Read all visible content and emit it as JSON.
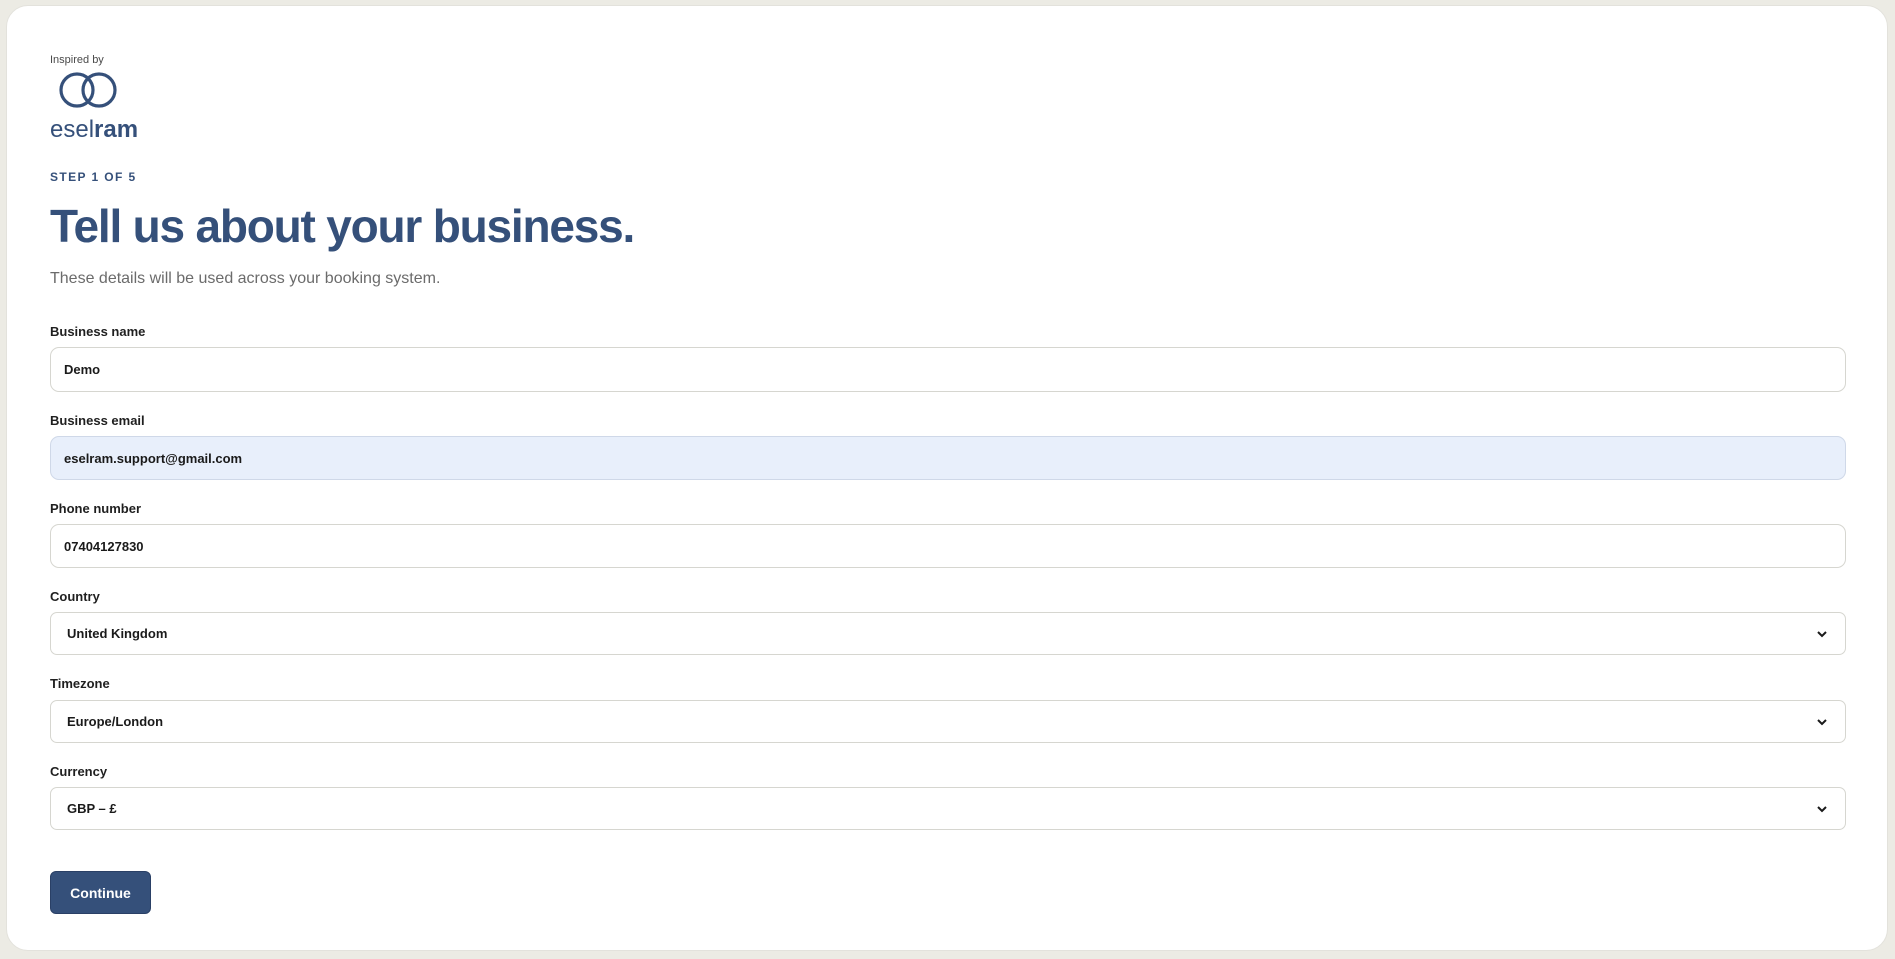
{
  "brand": {
    "inspired_by": "Inspired by",
    "logo_text_light": "esel",
    "logo_text_bold": "ram",
    "color": "#35507a"
  },
  "step": "STEP 1 OF 5",
  "title": "Tell us about your business.",
  "subtitle": "These details will be used across your booking system.",
  "fields": {
    "business_name": {
      "label": "Business name",
      "value": "Demo"
    },
    "business_email": {
      "label": "Business email",
      "value": "eselram.support@gmail.com"
    },
    "phone": {
      "label": "Phone number",
      "value": "07404127830"
    },
    "country": {
      "label": "Country",
      "value": "United Kingdom"
    },
    "timezone": {
      "label": "Timezone",
      "value": "Europe/London"
    },
    "currency": {
      "label": "Currency",
      "value": "GBP – £"
    }
  },
  "continue_label": "Continue",
  "icons": {
    "logo": "interlocking-rings-logo",
    "dropdown": "chevron-down-icon"
  }
}
